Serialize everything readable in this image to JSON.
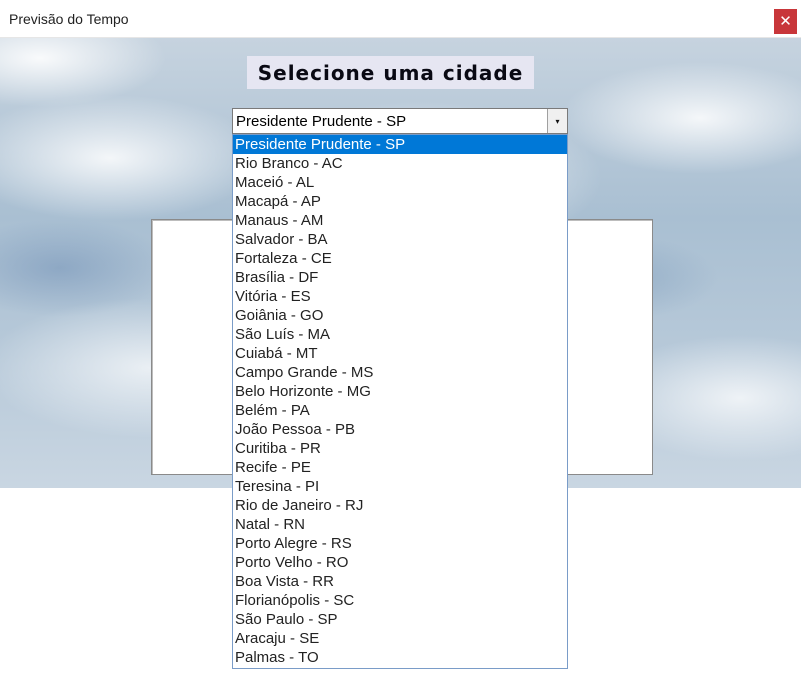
{
  "window": {
    "title": "Previsão do Tempo",
    "close_glyph": "✕",
    "close_color": "#c8363a"
  },
  "heading": "Selecione uma cidade",
  "select": {
    "value": "Presidente Prudente - SP",
    "arrow_icon": "chevron-down-icon",
    "arrow_glyph": "▾"
  },
  "options": [
    "Presidente Prudente - SP",
    "Rio Branco - AC",
    "Maceió - AL",
    "Macapá - AP",
    "Manaus - AM",
    "Salvador - BA",
    "Fortaleza - CE",
    "Brasília - DF",
    "Vitória - ES",
    "Goiânia - GO",
    "São Luís - MA",
    "Cuiabá - MT",
    "Campo Grande - MS",
    "Belo Horizonte - MG",
    "Belém - PA",
    "João Pessoa - PB",
    "Curitiba - PR",
    "Recife - PE",
    "Teresina - PI",
    "Rio de Janeiro - RJ",
    "Natal - RN",
    "Porto Alegre - RS",
    "Porto Velho - RO",
    "Boa Vista - RR",
    "Florianópolis - SC",
    "São Paulo - SP",
    "Aracaju - SE",
    "Palmas - TO"
  ],
  "selected_index": 0,
  "colors": {
    "selection": "#0078d7",
    "heading_bg": "#e6e6f2"
  }
}
